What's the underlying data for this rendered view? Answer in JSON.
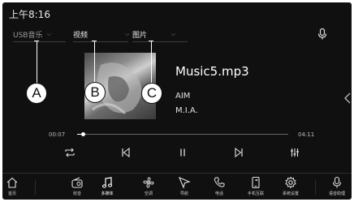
{
  "status": {
    "time": "上午8:16"
  },
  "source_tabs": [
    {
      "label": "USB音乐",
      "active": false
    },
    {
      "label": "视频",
      "active": true
    },
    {
      "label": "图片",
      "active": true
    }
  ],
  "now_playing": {
    "title": "Music5.mp3",
    "album": "AIM",
    "artist": "M.I.A.",
    "current_time": "00:07",
    "total_time": "04:11",
    "progress_fraction": 0.03
  },
  "callouts": {
    "a": "A",
    "b": "B",
    "c": "C"
  },
  "controls": [
    "repeat-icon",
    "previous-icon",
    "pause-icon",
    "next-icon",
    "equalizer-icon"
  ],
  "dock": [
    {
      "label": "首页",
      "icon": "home-icon"
    },
    {
      "label": "收音",
      "icon": "radio-icon"
    },
    {
      "label": "多媒体",
      "icon": "music-note-icon"
    },
    {
      "label": "空调",
      "icon": "fan-icon"
    },
    {
      "label": "导航",
      "icon": "navigation-icon"
    },
    {
      "label": "电话",
      "icon": "phone-icon"
    },
    {
      "label": "手机互联",
      "icon": "phone-link-icon"
    },
    {
      "label": "系统设置",
      "icon": "gear-icon"
    },
    {
      "label": "语音助理",
      "icon": "microphone-icon"
    }
  ],
  "colors": {
    "background": "#101010",
    "text": "#ffffff",
    "muted": "#9a9a9a"
  }
}
